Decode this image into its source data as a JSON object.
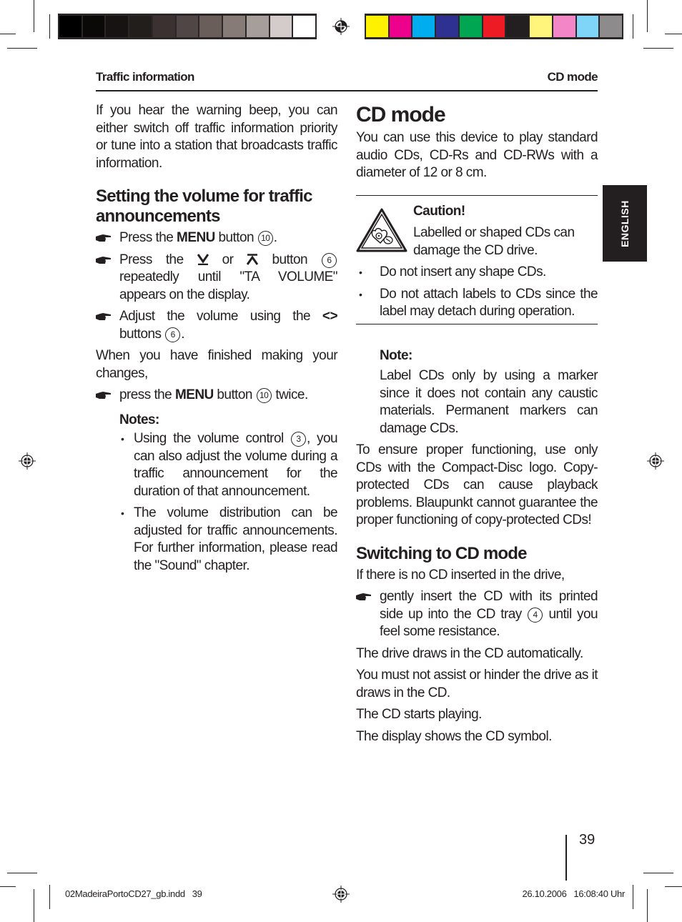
{
  "print_marks": {
    "gray_swatches": [
      "#000000",
      "#0b0908",
      "#161312",
      "#221e1c",
      "#3a3130",
      "#504645",
      "#6a5e5b",
      "#877b77",
      "#a69e9b",
      "#d4cccb",
      "#ffffff"
    ],
    "color_swatches": [
      "#fff200",
      "#ec008c",
      "#00aeef",
      "#2e3192",
      "#00a651",
      "#ed1c24",
      "#231f20",
      "#fff57c",
      "#f386c6",
      "#7fd5f7",
      "#8d8b8c"
    ]
  },
  "running_header": {
    "left": "Traffic information",
    "right": "CD mode"
  },
  "language_tab": "ENGLISH",
  "left_column": {
    "intro": "If you hear the warning beep, you can either switch off traffic information priority or tune into a station that broadcasts traffic information.",
    "heading": "Setting the volume for traffic announcements",
    "steps": [
      {
        "pre": "Press the ",
        "bold": "MENU",
        "mid": " button ",
        "ref": "10",
        "post": "."
      },
      {
        "pre": "Press the ",
        "sym1": "⩡",
        "or": " or ",
        "sym2": "⩠",
        "mid": " button ",
        "ref": "6",
        "post": " repeatedly until \"TA VOLUME\" appears on the display."
      },
      {
        "pre": "Adjust the volume using the ",
        "sym": "<>",
        "mid": " buttons ",
        "ref": "6",
        "post": "."
      }
    ],
    "finish_text": "When you have finished making your changes,",
    "final_step": {
      "pre": "press the ",
      "bold": "MENU",
      "mid": " button ",
      "ref": "10",
      "post": " twice."
    },
    "notes_title": "Notes:",
    "notes": [
      {
        "pre": "Using the volume control ",
        "ref": "3",
        "post": ", you can also adjust the volume during a traffic announcement for the duration of that announcement."
      },
      {
        "text": "The volume distribution can be adjusted for traffic announcements. For further information, please read the \"Sound\" chapter."
      }
    ]
  },
  "right_column": {
    "title": "CD mode",
    "intro": "You can use this device to play standard audio CDs, CD-Rs and CD-RWs with a diameter of 12 or 8 cm.",
    "caution": {
      "icon": "warning-cd-icon",
      "title": "Caution!",
      "text": "Labelled or shaped CDs can damage the CD drive.",
      "bullets": [
        "Do not insert any shape CDs.",
        "Do not attach labels to CDs since the label may detach during operation."
      ]
    },
    "note": {
      "title": "Note:",
      "text": "Label CDs only by using a marker since it does not contain any caustic materials. Permanent markers can damage CDs."
    },
    "functioning_text": "To ensure proper functioning, use only CDs with the Compact-Disc logo. Copy-protected CDs can cause playback problems. Blaupunkt cannot guarantee the proper functioning of copy-protected CDs!",
    "switch_heading": "Switching to CD mode",
    "switch_intro": "If there is no CD inserted in the drive,",
    "switch_step": {
      "pre": "gently insert the CD with its printed side up into the CD tray ",
      "ref": "4",
      "post": " until you feel some resistance."
    },
    "after": [
      "The drive draws in the CD automatically.",
      "You must not assist or hinder the drive as it draws in the CD.",
      "The CD starts playing.",
      "The display shows the CD symbol."
    ]
  },
  "page_number": "39",
  "slug": {
    "file": "02MadeiraPortoCD27_gb.indd   39",
    "datetime": "26.10.2006   16:08:40 Uhr"
  }
}
